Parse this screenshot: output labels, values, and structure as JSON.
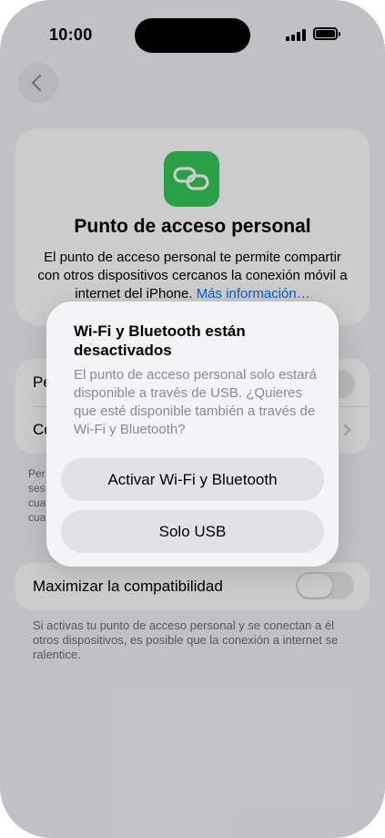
{
  "status_bar": {
    "time": "10:00"
  },
  "header": {
    "title": "Punto de acceso personal",
    "description": "El punto de acceso personal te permite compartir con otros dispositivos cercanos la conexión móvil a internet del iPhone.",
    "more_link": "Más información…"
  },
  "settings": {
    "row1_label": "Pe",
    "row2_label": "Co",
    "footnote_lines": [
      "Per",
      "ses",
      "cua",
      "cua"
    ]
  },
  "compatibility": {
    "label": "Maximizar la compatibilidad",
    "toggle_on": false,
    "footnote": "Si activas tu punto de acceso personal y se conectan a él otros dispositivos, es posible que la conexión a internet se ralentice."
  },
  "alert": {
    "title": "Wi-Fi y Bluetooth están desactivados",
    "message": "El punto de acceso personal solo estará disponible a través de USB. ¿Quieres que esté disponible también a través de Wi-Fi y Bluetooth?",
    "primary_button": "Activar Wi-Fi y Bluetooth",
    "secondary_button": "Solo USB"
  },
  "colors": {
    "accent": "#007aff",
    "icon_green": "#34c759",
    "background": "#f2f2f7"
  }
}
